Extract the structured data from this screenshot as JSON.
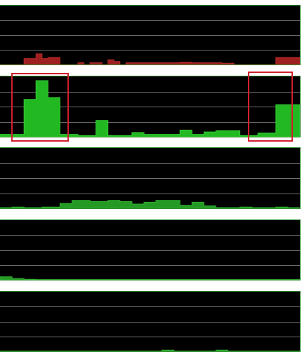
{
  "colors": {
    "background": "#000000",
    "gridline": "#6f6f6f",
    "border": "#2e8b2e",
    "highlight": "#d0202c"
  },
  "graphs": [
    {
      "name": "activity-graph-1",
      "fill": "#9e1f1f",
      "stroke": "#b82a2a",
      "levels": [
        0,
        0,
        0,
        0,
        0.1,
        0.1,
        0.18,
        0.1,
        0.12,
        0.12,
        0,
        0,
        0,
        0.03,
        0,
        0.03,
        0.03,
        0,
        0.08,
        0.05,
        0,
        0.03,
        0.03,
        0.03,
        0.03,
        0.03,
        0.03,
        0.03,
        0.03,
        0.03,
        0.04,
        0.04,
        0.03,
        0.03,
        0.03,
        0.03,
        0.03,
        0.02,
        0.02,
        0,
        0,
        0,
        0,
        0,
        0,
        0,
        0.12,
        0.12,
        0.12,
        0.12,
        0
      ]
    },
    {
      "name": "activity-graph-2",
      "fill": "#22b822",
      "stroke": "#35cc35",
      "levels": [
        0.04,
        0.04,
        0.04,
        0.04,
        0.62,
        0.62,
        0.93,
        0.93,
        0.65,
        0.65,
        0.04,
        0.04,
        0.04,
        0.02,
        0.02,
        0.02,
        0.27,
        0.27,
        0.02,
        0.02,
        0.02,
        0.02,
        0.07,
        0.07,
        0.04,
        0.04,
        0.04,
        0.04,
        0.04,
        0.04,
        0.11,
        0.11,
        0.04,
        0.04,
        0.08,
        0.08,
        0.1,
        0.1,
        0.1,
        0.1,
        0.02,
        0.02,
        0.02,
        0.06,
        0.06,
        0.06,
        0.53,
        0.53,
        0.53,
        0.53,
        0.04
      ]
    },
    {
      "name": "activity-graph-3",
      "fill": "#249a24",
      "stroke": "#30b030",
      "levels": [
        0.01,
        0.01,
        0.02,
        0.02,
        0.01,
        0.01,
        0.01,
        0.02,
        0.02,
        0.02,
        0.08,
        0.08,
        0.13,
        0.13,
        0.13,
        0.11,
        0.11,
        0.11,
        0.13,
        0.13,
        0.11,
        0.11,
        0.07,
        0.07,
        0.1,
        0.1,
        0.13,
        0.13,
        0.13,
        0.13,
        0.05,
        0.05,
        0.1,
        0.1,
        0.04,
        0.04,
        0.01,
        0.01,
        0.01,
        0.01,
        0.02,
        0.02,
        0.01,
        0.01,
        0.01,
        0.01,
        0.02,
        0.02,
        0.01,
        0.01,
        0.01
      ]
    },
    {
      "name": "activity-graph-4",
      "fill": "#249a24",
      "stroke": "#30b030",
      "levels": [
        0.05,
        0.05,
        0.02,
        0.02,
        0.01,
        0.01,
        0.005,
        0.005,
        0.005,
        0.005,
        0.005,
        0.005,
        0.005,
        0.005,
        0.005,
        0.005,
        0.005,
        0.005,
        0.005,
        0.005,
        0.005,
        0.005,
        0.005,
        0.005,
        0.005,
        0.005,
        0.005,
        0.005,
        0.005,
        0.005,
        0.005,
        0.005,
        0.005,
        0.005,
        0.005,
        0.005,
        0.005,
        0.005,
        0.005,
        0.005,
        0.005,
        0.005,
        0.005,
        0.005,
        0.005,
        0.005,
        0.005,
        0.005,
        0.005,
        0.005,
        0.005
      ]
    },
    {
      "name": "activity-graph-5",
      "fill": "#249a24",
      "stroke": "#30b030",
      "levels": [
        0.005,
        0.005,
        0.005,
        0.005,
        0.005,
        0.005,
        0.005,
        0.005,
        0.005,
        0.005,
        0.005,
        0.005,
        0.005,
        0.005,
        0.005,
        0.005,
        0.005,
        0.005,
        0.005,
        0.005,
        0.005,
        0.005,
        0.005,
        0.005,
        0.005,
        0.005,
        0.005,
        0.02,
        0.02,
        0.005,
        0.005,
        0.005,
        0.005,
        0.005,
        0.005,
        0.005,
        0.02,
        0.02,
        0.005,
        0.005,
        0.005,
        0.005,
        0.005,
        0.005,
        0.005,
        0.005,
        0.005,
        0.005,
        0.005,
        0.005,
        0.005
      ]
    }
  ]
}
